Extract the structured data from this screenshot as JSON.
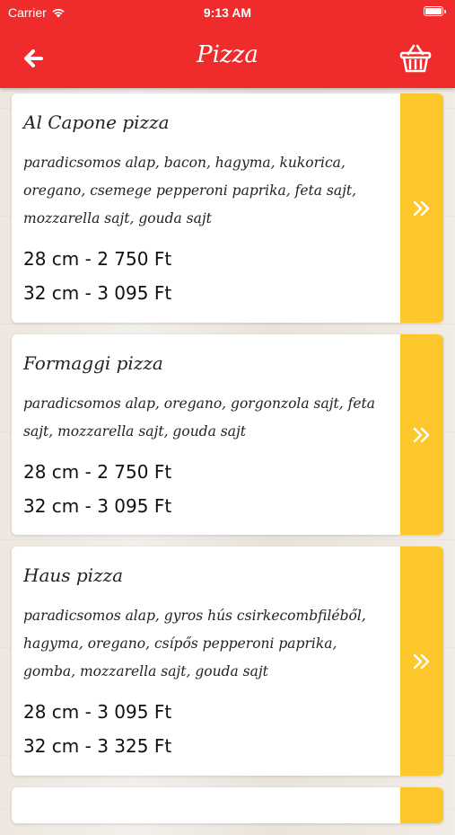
{
  "status_bar": {
    "carrier": "Carrier",
    "time": "9:13 AM"
  },
  "nav": {
    "title": "Pizza"
  },
  "pizzas": [
    {
      "name": "Al Capone pizza",
      "description": "paradicsomos alap, bacon, hagyma, kukorica, oregano, csemege pepperoni paprika, feta sajt, mozzarella sajt, gouda sajt",
      "price_28": "28 cm - 2 750 Ft",
      "price_32": "32 cm - 3 095 Ft"
    },
    {
      "name": "Formaggi pizza",
      "description": "paradicsomos alap, oregano, gorgonzola sajt, feta sajt, mozzarella sajt, gouda sajt",
      "price_28": "28 cm - 2 750 Ft",
      "price_32": "32 cm - 3 095 Ft"
    },
    {
      "name": "Haus pizza",
      "description": "paradicsomos alap, gyros hús csirkecombfiléből, hagyma, oregano, csípős pepperoni paprika, gomba, mozzarella sajt, gouda sajt",
      "price_28": "28 cm - 3 095 Ft",
      "price_32": "32 cm - 3 325 Ft"
    }
  ],
  "colors": {
    "accent": "#ef2b2b",
    "arrow_bg": "#fdc62a"
  },
  "icons": {
    "back": "arrow-left-icon",
    "cart": "basket-icon",
    "details": "double-chevron-right-icon"
  }
}
